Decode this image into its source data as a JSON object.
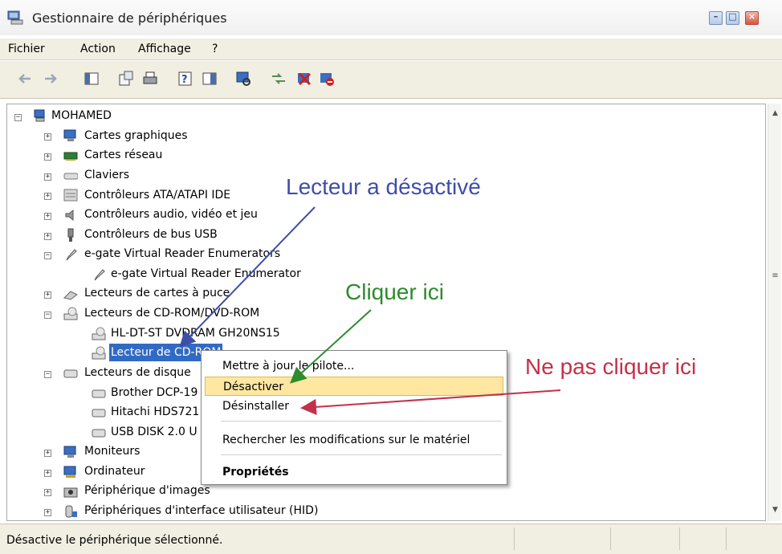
{
  "window": {
    "title": "Gestionnaire de périphériques",
    "min_glyph": "–",
    "max_glyph": "□",
    "close_glyph": "×"
  },
  "menu": [
    "Fichier",
    "Action",
    "Affichage",
    "?"
  ],
  "toolbar_icons": [
    "back-arrow-icon",
    "forward-arrow-icon",
    "console-tree-icon",
    "properties-icon",
    "print-icon",
    "help-icon",
    "show-hide-icon",
    "scan-hardware-icon",
    "update-driver-icon",
    "uninstall-icon",
    "disable-icon"
  ],
  "tree": {
    "root": "MOHAMED",
    "nodes": [
      {
        "label": "Cartes graphiques",
        "icon": "display-adapter-icon"
      },
      {
        "label": "Cartes réseau",
        "icon": "network-card-icon"
      },
      {
        "label": "Claviers",
        "icon": "keyboard-icon"
      },
      {
        "label": "Contrôleurs ATA/ATAPI IDE",
        "icon": "ide-controller-icon"
      },
      {
        "label": "Contrôleurs audio, vidéo et jeu",
        "icon": "audio-icon"
      },
      {
        "label": "Contrôleurs de bus USB",
        "icon": "usb-icon"
      },
      {
        "label": "e-gate Virtual Reader Enumerators",
        "icon": "reader-icon"
      },
      {
        "label": "e-gate Virtual Reader Enumerator",
        "icon": "reader-icon"
      },
      {
        "label": "Lecteurs de cartes à puce",
        "icon": "smartcard-icon"
      },
      {
        "label": "Lecteurs de CD-ROM/DVD-ROM",
        "icon": "cdrom-icon"
      },
      {
        "label": "HL-DT-ST DVDRAM GH20NS15",
        "icon": "cdrom-icon"
      },
      {
        "label": "Lecteur de CD-ROM",
        "icon": "cdrom-icon"
      },
      {
        "label": "Lecteurs de disque",
        "icon": "disk-drive-icon"
      },
      {
        "label": "Brother DCP-19",
        "icon": "disk-drive-icon"
      },
      {
        "label": "Hitachi HDS721",
        "icon": "disk-drive-icon"
      },
      {
        "label": "USB DISK 2.0 U",
        "icon": "disk-drive-icon"
      },
      {
        "label": "Moniteurs",
        "icon": "monitor-icon"
      },
      {
        "label": "Ordinateur",
        "icon": "computer-icon"
      },
      {
        "label": "Périphérique d'images",
        "icon": "imaging-icon"
      },
      {
        "label": "Périphériques d'interface utilisateur (HID)",
        "icon": "hid-icon"
      }
    ]
  },
  "context_menu": {
    "update": "Mettre à jour le pilote...",
    "disable": "Désactiver",
    "uninstall": "Désinstaller",
    "scan": "Rechercher les modifications sur le matériel",
    "properties": "Propriétés"
  },
  "annotations": {
    "disabled": "Lecteur a désactivé",
    "click": "Cliquer ici",
    "dont_click": "Ne pas cliquer ici"
  },
  "colors": {
    "annot_blue": "#3e4ea8",
    "annot_green": "#2e8b2e",
    "annot_red": "#c4304a",
    "selection": "#316ac5"
  },
  "status": "Désactive le périphérique sélectionné."
}
